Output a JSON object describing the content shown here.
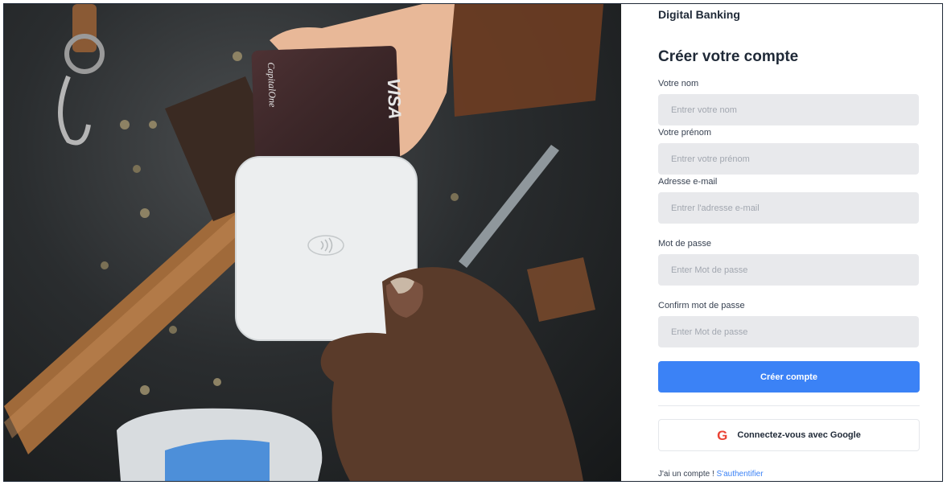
{
  "hero": {
    "image_subject": "hand-tapping-card-on-payment-terminal-photo",
    "card_brand_text": "VISA",
    "card_issuer_text": "CapitalOne"
  },
  "brand": "Digital Banking",
  "form": {
    "title": "Créer votre compte",
    "fields": [
      {
        "label": "Votre nom",
        "placeholder": "Entrer votre nom",
        "value": ""
      },
      {
        "label": "Votre prénom",
        "placeholder": "Entrer votre prénom",
        "value": ""
      },
      {
        "label": "Adresse e-mail",
        "placeholder": "Entrer l'adresse e-mail",
        "value": ""
      },
      {
        "label": "Mot de passe",
        "placeholder": "Enter Mot de passe",
        "value": ""
      },
      {
        "label": "Confirm mot de passe",
        "placeholder": "Enter Mot de passe",
        "value": ""
      }
    ],
    "submit_label": "Créer compte",
    "google_label": "Connectez-vous avec Google",
    "google_icon": "google-g-icon",
    "footer_text": "J'ai un compte ! ",
    "footer_link": "S'authentifier"
  },
  "colors": {
    "primary": "#3b82f6",
    "input_bg": "#e8e9ec",
    "text": "#1f2937",
    "google_red": "#ea4335"
  }
}
